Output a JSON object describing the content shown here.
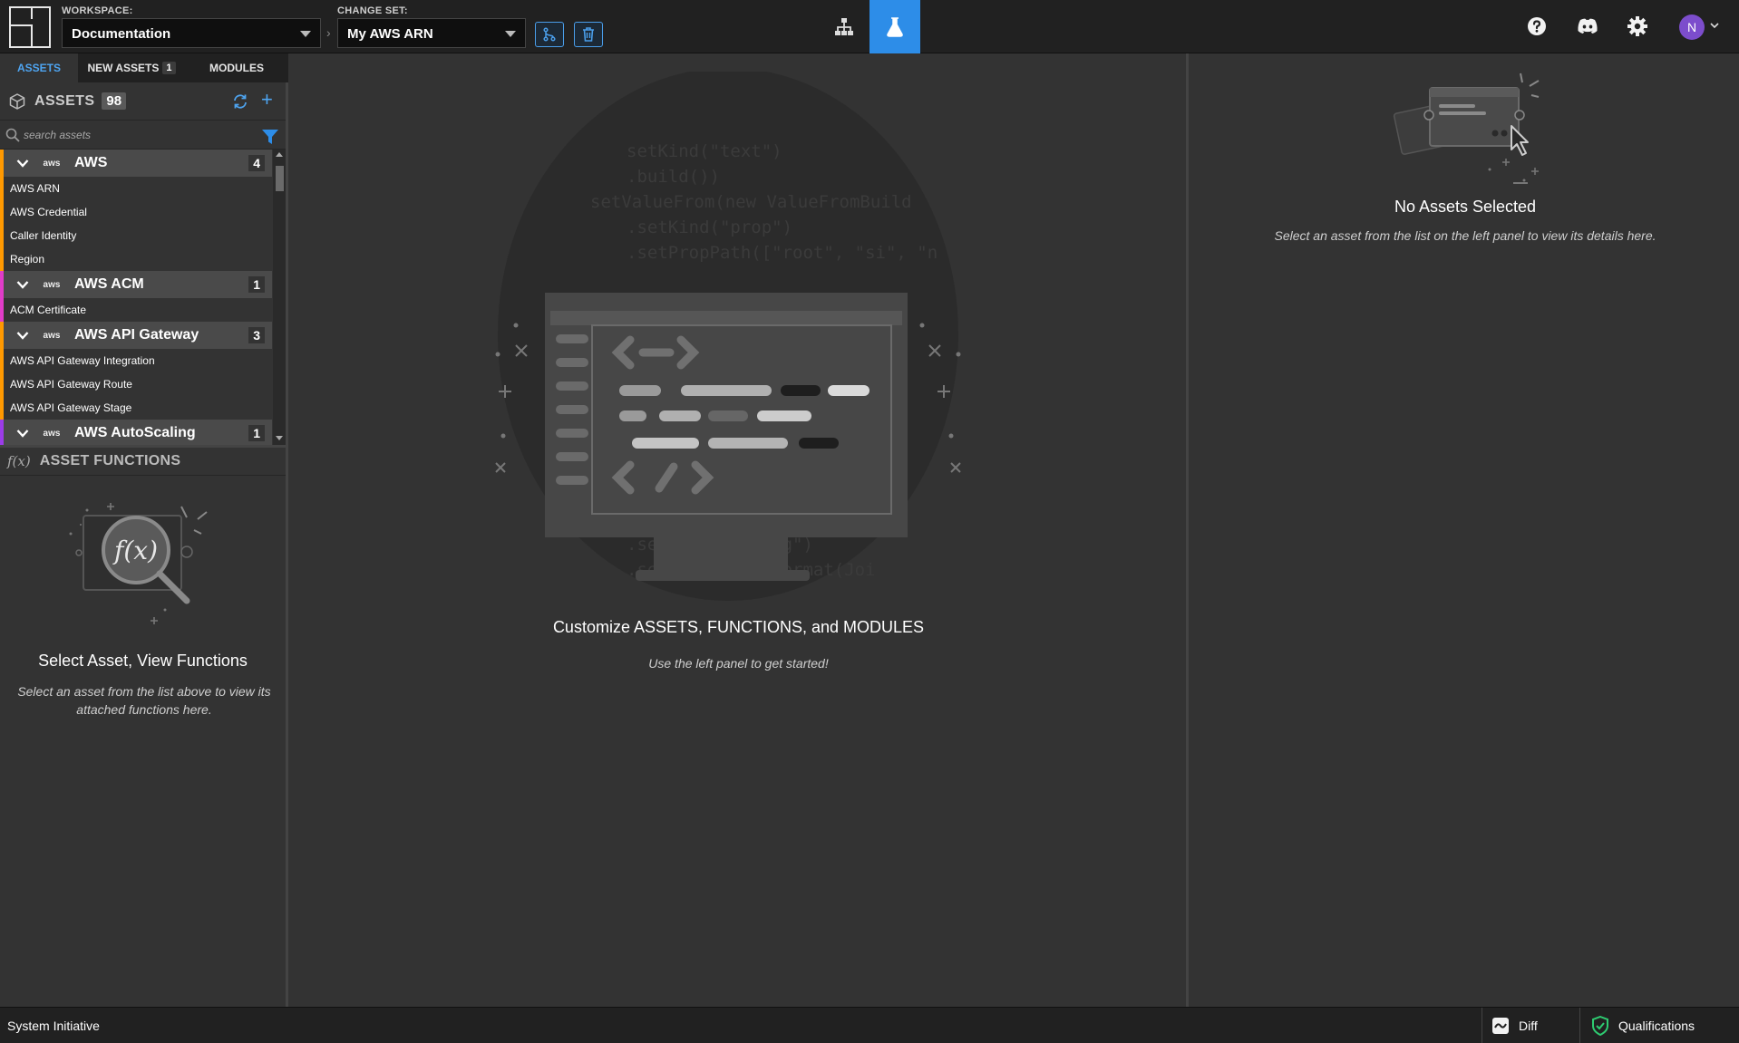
{
  "topbar": {
    "workspace_label": "WORKSPACE:",
    "workspace_value": "Documentation",
    "changeset_label": "CHANGE SET:",
    "changeset_value": "My AWS ARN",
    "arrow": "›",
    "notification_count": "1",
    "avatar_initial": "N",
    "active_nav": "customize",
    "accent_color": "#2d8de8"
  },
  "left_panel": {
    "tabs": [
      {
        "label": "ASSETS",
        "active": true
      },
      {
        "label": "NEW ASSETS",
        "count": "1",
        "active": false
      },
      {
        "label": "MODULES",
        "active": false
      }
    ],
    "assets_title": "ASSETS",
    "assets_count": "98",
    "search_placeholder": "search assets",
    "categories": [
      {
        "name": "AWS",
        "count": "4",
        "logo": "aws",
        "color": "#ff9900",
        "items": [
          "AWS ARN",
          "AWS Credential",
          "Caller Identity",
          "Region"
        ]
      },
      {
        "name": "AWS ACM",
        "count": "1",
        "logo": "aws",
        "color": "#e03cc8",
        "items": [
          "ACM Certificate"
        ]
      },
      {
        "name": "AWS API Gateway",
        "count": "3",
        "logo": "aws",
        "color": "#ff9900",
        "items": [
          "AWS API Gateway Integration",
          "AWS API Gateway Route",
          "AWS API Gateway Stage"
        ]
      },
      {
        "name": "AWS AutoScaling",
        "count": "1",
        "logo": "aws",
        "color": "#9c3ce8",
        "items": []
      }
    ],
    "functions_icon": "f(x)",
    "functions_title": "ASSET FUNCTIONS",
    "functions_empty_title": "Select Asset, View Functions",
    "functions_empty_desc": "Select an asset from the list above to view its attached functions here."
  },
  "center": {
    "title": "Customize ASSETS, FUNCTIONS, and MODULES",
    "subtitle": "Use the left panel to get started!"
  },
  "right_panel": {
    "title": "No Assets Selected",
    "desc": "Select an asset from the list on the left panel to view its details here."
  },
  "statusbar": {
    "title": "System Initiative",
    "diff_label": "Diff",
    "qualifications_label": "Qualifications"
  }
}
